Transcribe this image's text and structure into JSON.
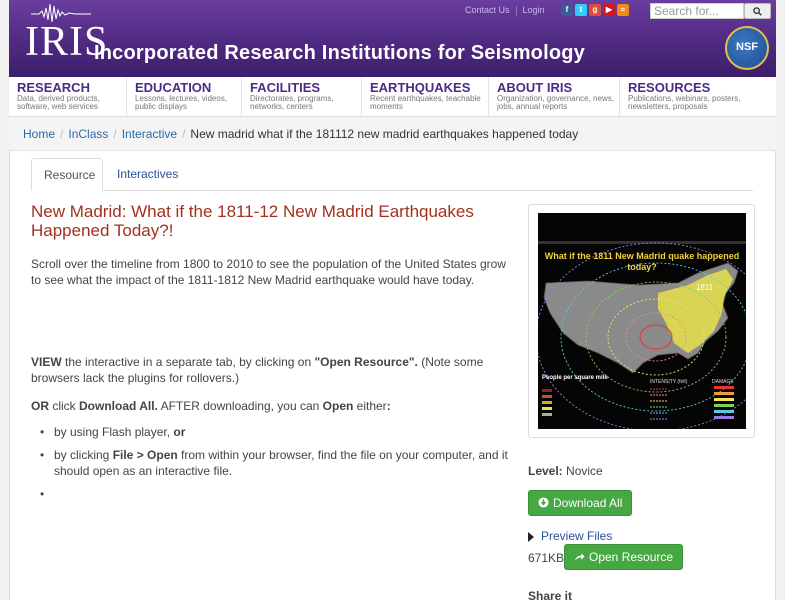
{
  "header": {
    "logo_text": "IRIS",
    "site_title": "Incorporated Research Institutions for Seismology",
    "contact_label": "Contact Us",
    "login_label": "Login",
    "search_placeholder": "Search for...",
    "search_button": "🔍",
    "nsf_label": "NSF",
    "social_icons": [
      "facebook-icon",
      "twitter-icon",
      "googleplus-icon",
      "youtube-icon",
      "rss-icon"
    ]
  },
  "nav": [
    {
      "title": "RESEARCH",
      "desc": "Data, derived products, software, web services"
    },
    {
      "title": "EDUCATION",
      "desc": "Lessons, lectures, videos, public displays"
    },
    {
      "title": "FACILITIES",
      "desc": "Directorates, programs, networks, centers"
    },
    {
      "title": "EARTHQUAKES",
      "desc": "Recent earthquakes, teachable moments"
    },
    {
      "title": "ABOUT IRIS",
      "desc": "Organization, governance, news, jobs, annual reports"
    },
    {
      "title": "RESOURCES",
      "desc": "Publications, webinars, posters, newsletters, proposals"
    }
  ],
  "breadcrumb": {
    "home": "Home",
    "inclass": "InClass",
    "interactive": "Interactive",
    "current": "New madrid what if the 181112 new madrid earthquakes happened today"
  },
  "tabs": {
    "resource": "Resource",
    "interactives": "Interactives"
  },
  "content": {
    "title": "New Madrid: What if the 1811-12 New Madrid Earthquakes Happened Today?!",
    "description": "Scroll over the timeline from 1800 to 2010 to see the population of the United States grow to see what the impact of the 1811-1812 New Madrid earthquake would have today.",
    "view_strong": "VIEW",
    "view_mid": " the interactive in a separate tab, by clicking on ",
    "view_quote": "\"Open Resource\".",
    "view_tail": " (Note some browsers lack the plugins for rollovers.)",
    "or_or": "OR",
    "or_click": " click ",
    "or_download": "Download All.",
    "or_after": "  AFTER downloading, you can ",
    "or_open": "Open",
    "or_either": " either",
    "or_colon": ":",
    "bullet1_text": "by using Flash player, ",
    "bullet1_or": "or",
    "bullet2_pre": "by clicking ",
    "bullet2_bold": "File > Open",
    "bullet2_post": " from within your browser, find the file on your computer, and it should open as an interactive file."
  },
  "sidebar": {
    "thumb_title": "What if the 1811 New Madrid quake happened today?",
    "thumb_year": "1811",
    "thumb_legend1": "People per square mile",
    "thumb_legend2": "INTENSITY (felt)",
    "thumb_legend3": "DAMAGE",
    "level_label": "Level:",
    "level_value": " Novice",
    "download_all": "Download All",
    "preview_files": "Preview Files",
    "file_size": "671KB",
    "open_resource": "Open Resource",
    "share": "Share it"
  },
  "colors": {
    "header_purple": "#4f2a82",
    "title_red": "#a2311e",
    "link_blue": "#2a4f99",
    "button_green": "#45a842"
  }
}
